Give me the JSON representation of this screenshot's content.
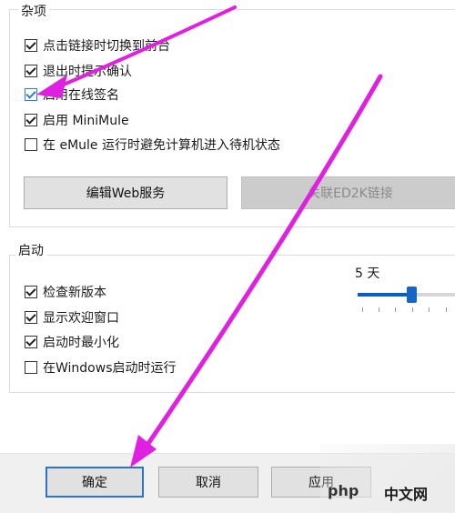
{
  "misc_group": {
    "title": "杂项",
    "options": [
      {
        "label": "点击链接时切换到前台",
        "checked": true
      },
      {
        "label": "退出时提示确认",
        "checked": true
      },
      {
        "label": "启用在线签名",
        "checked": true
      },
      {
        "label": "启用 MiniMule",
        "checked": true
      },
      {
        "label": "在 eMule 运行时避免计算机进入待机状态",
        "checked": false
      }
    ],
    "edit_web_button": "编辑Web服务",
    "associate_ed2k_button": "关联ED2K链接"
  },
  "startup_group": {
    "title": "启动",
    "options": [
      {
        "label": "检查新版本",
        "checked": true
      },
      {
        "label": "显示欢迎窗口",
        "checked": true
      },
      {
        "label": "启动时最小化",
        "checked": true
      },
      {
        "label": "在Windows启动时运行",
        "checked": false
      }
    ],
    "update_interval_label": "5 天",
    "update_interval_fraction": 0.55
  },
  "footer": {
    "ok_button": "确定",
    "cancel_button": "取消",
    "apply_button": "应用"
  },
  "watermark": {
    "text": "php",
    "site": "中文网"
  },
  "colors": {
    "accent": "#1565c8",
    "annotation_arrow": "#e020e0"
  }
}
